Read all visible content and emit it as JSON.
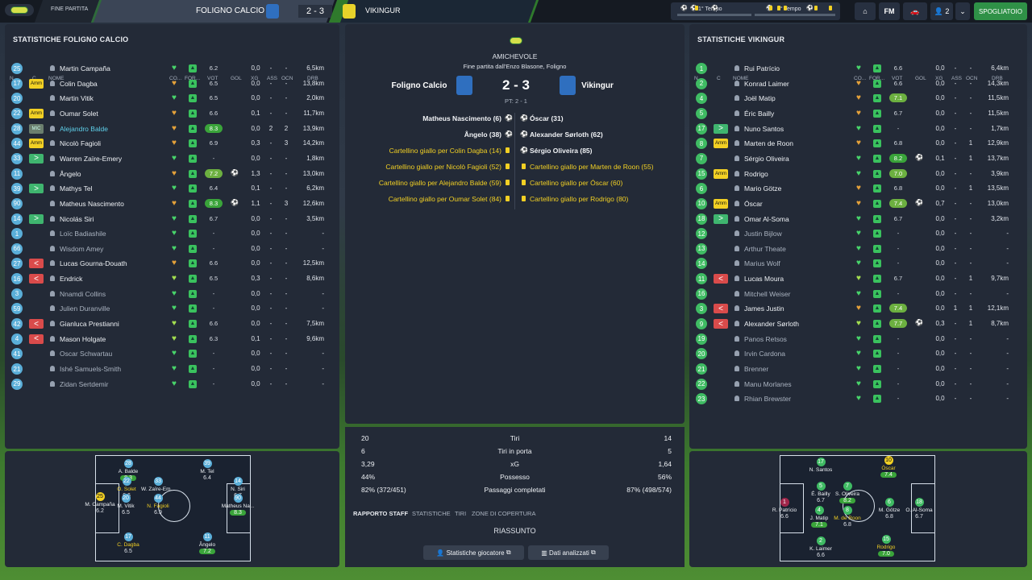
{
  "topbar": {
    "status": "FINE PARTITA",
    "home": "FOLIGNO CALCIO",
    "score": "2 - 3",
    "away": "VIKINGUR",
    "half1": "1° Tempo",
    "half2": "2° Tempo",
    "fm": "FM",
    "count": "2",
    "spogliatoio": "SPOGLIATOIO",
    "colors": {
      "home_crest": "#2f6fbf",
      "away_crest": "#e8d22a",
      "accent_green": "#2f9147"
    }
  },
  "home": {
    "title": "STATISTICHE FOLIGNO CALCIO",
    "headers": {
      "n": "N.",
      "c": "C",
      "name": "NOME",
      "co": "CO...",
      "for": "FOR...",
      "vot": "VOT",
      "gol": "GOL",
      "xg": "XG",
      "ass": "ASS",
      "ocn": "OCN",
      "drb": "DRB"
    },
    "players": [
      {
        "n": "25",
        "tag": "",
        "name": "Martin Campaña",
        "heart": "green",
        "vot": "6.2",
        "vhl": "",
        "gol": "",
        "xg": "0,0",
        "ass": "-",
        "ocn": "-",
        "drb": "6,5km"
      },
      {
        "n": "17",
        "tag": "Amm",
        "name": "Colin Dagba",
        "heart": "orange",
        "vot": "6.5",
        "vhl": "",
        "gol": "",
        "xg": "0,0",
        "ass": "-",
        "ocn": "-",
        "drb": "13,8km"
      },
      {
        "n": "20",
        "tag": "",
        "name": "Martin Vitik",
        "heart": "green",
        "vot": "6.5",
        "vhl": "",
        "gol": "",
        "xg": "0,0",
        "ass": "-",
        "ocn": "-",
        "drb": "2,0km"
      },
      {
        "n": "22",
        "tag": "Amm",
        "name": "Oumar Solet",
        "heart": "orange",
        "vot": "6.6",
        "vhl": "",
        "gol": "",
        "xg": "0,1",
        "ass": "-",
        "ocn": "-",
        "drb": "11,7km"
      },
      {
        "n": "28",
        "tag": "MIC",
        "name": "Alejandro Balde",
        "heart": "orange",
        "vot": "8.3",
        "vhl": "hi",
        "gol": "",
        "xg": "0,0",
        "ass": "2",
        "ocn": "2",
        "drb": "13,9km",
        "cyan": true
      },
      {
        "n": "44",
        "tag": "Amm",
        "name": "Nicolò Fagioli",
        "heart": "orange",
        "vot": "6.9",
        "vhl": "",
        "gol": "",
        "xg": "0,3",
        "ass": "-",
        "ocn": "3",
        "drb": "14,2km"
      },
      {
        "n": "33",
        "tag": ">",
        "name": "Warren Zaïre-Emery",
        "heart": "green",
        "vot": "-",
        "vhl": "",
        "gol": "",
        "xg": "0,0",
        "ass": "-",
        "ocn": "-",
        "drb": "1,8km"
      },
      {
        "n": "11",
        "tag": "",
        "name": "Ângelo",
        "heart": "orange",
        "vot": "7.2",
        "vhl": "mid",
        "gol": "⚽",
        "xg": "1,3",
        "ass": "-",
        "ocn": "-",
        "drb": "13,0km"
      },
      {
        "n": "39",
        "tag": ">",
        "name": "Mathys Tel",
        "heart": "green",
        "vot": "6.4",
        "vhl": "",
        "gol": "",
        "xg": "0,1",
        "ass": "-",
        "ocn": "-",
        "drb": "6,2km"
      },
      {
        "n": "90",
        "tag": "",
        "name": "Matheus Nascimento",
        "heart": "orange",
        "vot": "8.3",
        "vhl": "hi",
        "gol": "⚽",
        "xg": "1,1",
        "ass": "-",
        "ocn": "3",
        "drb": "12,6km"
      },
      {
        "n": "14",
        "tag": ">",
        "name": "Nicolás Siri",
        "heart": "green",
        "vot": "6.7",
        "vhl": "",
        "gol": "",
        "xg": "0,0",
        "ass": "-",
        "ocn": "-",
        "drb": "3,5km"
      },
      {
        "n": "1",
        "tag": "",
        "name": "Loïc Badiashile",
        "heart": "green",
        "vot": "-",
        "vhl": "",
        "gol": "",
        "xg": "0,0",
        "ass": "-",
        "ocn": "-",
        "drb": "-",
        "dim": true
      },
      {
        "n": "66",
        "tag": "",
        "name": "Wisdom Amey",
        "heart": "green",
        "vot": "-",
        "vhl": "",
        "gol": "",
        "xg": "0,0",
        "ass": "-",
        "ocn": "-",
        "drb": "-",
        "dim": true
      },
      {
        "n": "27",
        "tag": "<",
        "name": "Lucas Gourna-Douath",
        "heart": "orange",
        "vot": "6.6",
        "vhl": "",
        "gol": "",
        "xg": "0,0",
        "ass": "-",
        "ocn": "-",
        "drb": "12,5km"
      },
      {
        "n": "16",
        "tag": "<",
        "name": "Endrick",
        "heart": "lime",
        "vot": "6.5",
        "vhl": "",
        "gol": "",
        "xg": "0,3",
        "ass": "-",
        "ocn": "-",
        "drb": "8,6km"
      },
      {
        "n": "3",
        "tag": "",
        "name": "Nnamdi Collins",
        "heart": "green",
        "vot": "-",
        "vhl": "",
        "gol": "",
        "xg": "0,0",
        "ass": "-",
        "ocn": "-",
        "drb": "-",
        "dim": true
      },
      {
        "n": "59",
        "tag": "",
        "name": "Julien Duranville",
        "heart": "green",
        "vot": "-",
        "vhl": "",
        "gol": "",
        "xg": "0,0",
        "ass": "-",
        "ocn": "-",
        "drb": "-",
        "dim": true
      },
      {
        "n": "42",
        "tag": "<",
        "name": "Gianluca Prestianni",
        "heart": "lime",
        "vot": "6.6",
        "vhl": "",
        "gol": "",
        "xg": "0,0",
        "ass": "-",
        "ocn": "-",
        "drb": "7,5km"
      },
      {
        "n": "4",
        "tag": "<",
        "name": "Mason Holgate",
        "heart": "lime",
        "vot": "6.3",
        "vhl": "",
        "gol": "",
        "xg": "0,1",
        "ass": "-",
        "ocn": "-",
        "drb": "9,6km"
      },
      {
        "n": "41",
        "tag": "",
        "name": "Oscar Schwartau",
        "heart": "green",
        "vot": "-",
        "vhl": "",
        "gol": "",
        "xg": "0,0",
        "ass": "-",
        "ocn": "-",
        "drb": "-",
        "dim": true
      },
      {
        "n": "21",
        "tag": "",
        "name": "Ishé Samuels-Smith",
        "heart": "green",
        "vot": "-",
        "vhl": "",
        "gol": "",
        "xg": "0,0",
        "ass": "-",
        "ocn": "-",
        "drb": "-",
        "dim": true
      },
      {
        "n": "29",
        "tag": "",
        "name": "Zidan Sertdemir",
        "heart": "green",
        "vot": "-",
        "vhl": "",
        "gol": "",
        "xg": "0,0",
        "ass": "-",
        "ocn": "-",
        "drb": "-",
        "dim": true
      }
    ],
    "formation": [
      {
        "n": "28",
        "name": "A. Balde",
        "rating": "8.3",
        "hi": true
      },
      {
        "n": "39",
        "name": "M. Tel",
        "rating": "6.4"
      },
      {
        "n": "22",
        "name": "O. Solet",
        "rating": "6.6",
        "yellow": true
      },
      {
        "n": "33",
        "name": "W. Zaïre-Em...",
        "rating": ""
      },
      {
        "n": "14",
        "name": "N. Siri",
        "rating": "6.7"
      },
      {
        "n": "25",
        "name": "M. Campaña",
        "rating": "6.2",
        "yellowNum": true
      },
      {
        "n": "20",
        "name": "M. Vitik",
        "rating": "6.5"
      },
      {
        "n": "44",
        "name": "N. Fagioli",
        "rating": "6.9",
        "yellow": true
      },
      {
        "n": "90",
        "name": "Matheus Na...",
        "rating": "8.3",
        "hi": true
      },
      {
        "n": "17",
        "name": "C. Dagba",
        "rating": "6.5",
        "yellow": true
      },
      {
        "n": "11",
        "name": "Ângelo",
        "rating": "7.2",
        "hi": true
      }
    ]
  },
  "away": {
    "title": "STATISTICHE VIKINGUR",
    "players": [
      {
        "n": "1",
        "tag": "",
        "name": "Rui Patrício",
        "heart": "green",
        "vot": "6.6",
        "vhl": "",
        "gol": "",
        "xg": "0,0",
        "ass": "-",
        "ocn": "-",
        "drb": "6,4km"
      },
      {
        "n": "2",
        "tag": "",
        "name": "Konrad Laimer",
        "heart": "orange",
        "vot": "6.6",
        "vhl": "",
        "gol": "",
        "xg": "0,0",
        "ass": "-",
        "ocn": "-",
        "drb": "14,3km"
      },
      {
        "n": "4",
        "tag": "",
        "name": "Joël Matip",
        "heart": "orange",
        "vot": "7.1",
        "vhl": "mid",
        "gol": "",
        "xg": "0,0",
        "ass": "-",
        "ocn": "-",
        "drb": "11,5km"
      },
      {
        "n": "5",
        "tag": "",
        "name": "Éric Bailly",
        "heart": "orange",
        "vot": "6.7",
        "vhl": "",
        "gol": "",
        "xg": "0,0",
        "ass": "-",
        "ocn": "-",
        "drb": "11,5km"
      },
      {
        "n": "17",
        "tag": ">",
        "name": "Nuno Santos",
        "heart": "green",
        "vot": "-",
        "vhl": "",
        "gol": "",
        "xg": "0,0",
        "ass": "-",
        "ocn": "-",
        "drb": "1,7km"
      },
      {
        "n": "8",
        "tag": "Amm",
        "name": "Marten de Roon",
        "heart": "orange",
        "vot": "6.8",
        "vhl": "",
        "gol": "",
        "xg": "0,0",
        "ass": "-",
        "ocn": "1",
        "drb": "12,9km"
      },
      {
        "n": "7",
        "tag": "",
        "name": "Sérgio Oliveira",
        "heart": "green",
        "vot": "8.2",
        "vhl": "hi",
        "gol": "⚽",
        "xg": "0,1",
        "ass": "-",
        "ocn": "1",
        "drb": "13,7km"
      },
      {
        "n": "15",
        "tag": "Amm",
        "name": "Rodrigo",
        "heart": "green",
        "vot": "7.0",
        "vhl": "mid",
        "gol": "",
        "xg": "0,0",
        "ass": "-",
        "ocn": "-",
        "drb": "3,9km"
      },
      {
        "n": "6",
        "tag": "",
        "name": "Mario Götze",
        "heart": "orange",
        "vot": "6.8",
        "vhl": "",
        "gol": "",
        "xg": "0,0",
        "ass": "-",
        "ocn": "1",
        "drb": "13,5km"
      },
      {
        "n": "10",
        "tag": "Amm",
        "name": "Óscar",
        "heart": "orange",
        "vot": "7.4",
        "vhl": "mid",
        "gol": "⚽",
        "xg": "0,7",
        "ass": "-",
        "ocn": "-",
        "drb": "13,0km"
      },
      {
        "n": "18",
        "tag": ">",
        "name": "Omar Al-Soma",
        "heart": "green",
        "vot": "6.7",
        "vhl": "",
        "gol": "",
        "xg": "0,0",
        "ass": "-",
        "ocn": "-",
        "drb": "3,2km"
      },
      {
        "n": "12",
        "tag": "",
        "name": "Justin Bijlow",
        "heart": "green",
        "vot": "-",
        "vhl": "",
        "gol": "",
        "xg": "0,0",
        "ass": "-",
        "ocn": "-",
        "drb": "-",
        "dim": true
      },
      {
        "n": "13",
        "tag": "",
        "name": "Arthur Theate",
        "heart": "green",
        "vot": "-",
        "vhl": "",
        "gol": "",
        "xg": "0,0",
        "ass": "-",
        "ocn": "-",
        "drb": "-",
        "dim": true
      },
      {
        "n": "14",
        "tag": "",
        "name": "Marius Wolf",
        "heart": "green",
        "vot": "-",
        "vhl": "",
        "gol": "",
        "xg": "0,0",
        "ass": "-",
        "ocn": "-",
        "drb": "-",
        "dim": true
      },
      {
        "n": "11",
        "tag": "<",
        "name": "Lucas Moura",
        "heart": "lime",
        "vot": "6.7",
        "vhl": "",
        "gol": "",
        "xg": "0,0",
        "ass": "-",
        "ocn": "1",
        "drb": "9,7km"
      },
      {
        "n": "16",
        "tag": "",
        "name": "Mitchell Weiser",
        "heart": "green",
        "vot": "-",
        "vhl": "",
        "gol": "",
        "xg": "0,0",
        "ass": "-",
        "ocn": "-",
        "drb": "-",
        "dim": true
      },
      {
        "n": "3",
        "tag": "<",
        "name": "James Justin",
        "heart": "orange",
        "vot": "7.4",
        "vhl": "mid",
        "gol": "",
        "xg": "0,0",
        "ass": "1",
        "ocn": "1",
        "drb": "12,1km"
      },
      {
        "n": "9",
        "tag": "<",
        "name": "Alexander Sørloth",
        "heart": "lime",
        "vot": "7.7",
        "vhl": "mid",
        "gol": "⚽",
        "xg": "0,3",
        "ass": "-",
        "ocn": "1",
        "drb": "8,7km"
      },
      {
        "n": "19",
        "tag": "",
        "name": "Panos Retsos",
        "heart": "green",
        "vot": "-",
        "vhl": "",
        "gol": "",
        "xg": "0,0",
        "ass": "-",
        "ocn": "-",
        "drb": "-",
        "dim": true
      },
      {
        "n": "20",
        "tag": "",
        "name": "Irvin Cardona",
        "heart": "green",
        "vot": "-",
        "vhl": "",
        "gol": "",
        "xg": "0,0",
        "ass": "-",
        "ocn": "-",
        "drb": "-",
        "dim": true
      },
      {
        "n": "21",
        "tag": "",
        "name": "Brenner",
        "heart": "green",
        "vot": "-",
        "vhl": "",
        "gol": "",
        "xg": "0,0",
        "ass": "-",
        "ocn": "-",
        "drb": "-",
        "dim": true
      },
      {
        "n": "22",
        "tag": "",
        "name": "Manu Morlanes",
        "heart": "green",
        "vot": "-",
        "vhl": "",
        "gol": "",
        "xg": "0,0",
        "ass": "-",
        "ocn": "-",
        "drb": "-",
        "dim": true
      },
      {
        "n": "23",
        "tag": "",
        "name": "Rhian Brewster",
        "heart": "green",
        "vot": "-",
        "vhl": "",
        "gol": "",
        "xg": "0,0",
        "ass": "-",
        "ocn": "-",
        "drb": "-",
        "dim": true
      }
    ],
    "formation": [
      {
        "n": "17",
        "name": "N. Santos",
        "rating": ""
      },
      {
        "n": "10",
        "name": "Óscar",
        "rating": "7.4",
        "hi": true,
        "yellow": true,
        "yellowNum": true
      },
      {
        "n": "5",
        "name": "É. Bailly",
        "rating": "6.7"
      },
      {
        "n": "7",
        "name": "S. Oliveira",
        "rating": "8.2",
        "hi": true
      },
      {
        "n": "1",
        "name": "R. Patrício",
        "rating": "6.6",
        "maroon": true
      },
      {
        "n": "6",
        "name": "M. Götze",
        "rating": "6.8"
      },
      {
        "n": "18",
        "name": "O. Al-Soma",
        "rating": "6.7"
      },
      {
        "n": "4",
        "name": "J. Matip",
        "rating": "7.1",
        "hi": true
      },
      {
        "n": "8",
        "name": "M. de Roon",
        "rating": "6.8",
        "yellow": true
      },
      {
        "n": "2",
        "name": "K. Laimer",
        "rating": "6.6"
      },
      {
        "n": "15",
        "name": "Rodrigo",
        "rating": "7.0",
        "hi": true,
        "yellow": true
      }
    ]
  },
  "match": {
    "type": "AMICHEVOLE",
    "venue": "Fine partita dall'Enzo Blasone, Foligno",
    "home": "Foligno Calcio",
    "away": "Vikingur",
    "score": "2 - 3",
    "ht": "PT: 2 - 1",
    "home_events": [
      {
        "text": "Matheus Nascimento (6)",
        "kind": "goal"
      },
      {
        "text": "Ângelo (38)",
        "kind": "goal"
      },
      {
        "text": "Cartellino giallo per Colin Dagba (14)",
        "kind": "card"
      },
      {
        "text": "Cartellino giallo per Nicolò Fagioli (52)",
        "kind": "card"
      },
      {
        "text": "Cartellino giallo per Alejandro Balde (59)",
        "kind": "card"
      },
      {
        "text": "Cartellino giallo per Oumar Solet (84)",
        "kind": "card"
      }
    ],
    "away_events": [
      {
        "text": "Óscar (31)",
        "kind": "goal"
      },
      {
        "text": "Alexander Sørloth (62)",
        "kind": "goal"
      },
      {
        "text": "Sérgio Oliveira (85)",
        "kind": "goal"
      },
      {
        "text": "Cartellino giallo per Marten de Roon (55)",
        "kind": "card"
      },
      {
        "text": "Cartellino giallo per Óscar (60)",
        "kind": "card"
      },
      {
        "text": "Cartellino giallo per Rodrigo (80)",
        "kind": "card"
      }
    ],
    "stats": [
      {
        "home": "20",
        "label": "Tiri",
        "away": "14"
      },
      {
        "home": "6",
        "label": "Tiri in porta",
        "away": "5"
      },
      {
        "home": "3,29",
        "label": "xG",
        "away": "1,64"
      },
      {
        "home": "44%",
        "label": "Possesso",
        "away": "56%"
      },
      {
        "home": "82% (372/451)",
        "label": "Passaggi completati",
        "away": "87% (498/574)"
      }
    ],
    "tabs": [
      "RAPPORTO STAFF",
      "STATISTICHE",
      "TIRI",
      "ZONE DI COPERTURA"
    ],
    "summary": "RIASSUNTO",
    "btn_player_stats": "Statistiche giocatore",
    "btn_data": "Dati analizzati"
  }
}
